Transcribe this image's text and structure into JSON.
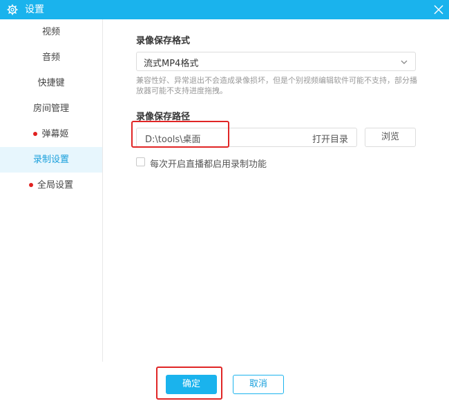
{
  "window": {
    "title": "设置",
    "accent_color": "#1ab3ed",
    "icons": {
      "title_icon": "gear-icon",
      "close": "close-icon"
    }
  },
  "sidebar": {
    "items": [
      {
        "label": "视频",
        "has_dot": false
      },
      {
        "label": "音频",
        "has_dot": false
      },
      {
        "label": "快捷键",
        "has_dot": false
      },
      {
        "label": "房间管理",
        "has_dot": false
      },
      {
        "label": "弹幕姬",
        "has_dot": true
      },
      {
        "label": "录制设置",
        "has_dot": false,
        "active": true
      },
      {
        "label": "全局设置",
        "has_dot": true
      }
    ]
  },
  "main": {
    "format_label": "录像保存格式",
    "format_value": "流式MP4格式",
    "format_hint": "兼容性好、异常退出不会造成录像损坏，但是个别视频编辑软件可能不支持，部分播放器可能不支持进度拖拽。",
    "path_label": "录像保存路径",
    "path_value": "D:\\tools\\桌面",
    "open_dir_label": "打开目录",
    "browse_label": "浏览",
    "auto_record_label": "每次开启直播都启用录制功能",
    "auto_record_checked": false
  },
  "footer": {
    "ok_label": "确定",
    "cancel_label": "取消"
  }
}
